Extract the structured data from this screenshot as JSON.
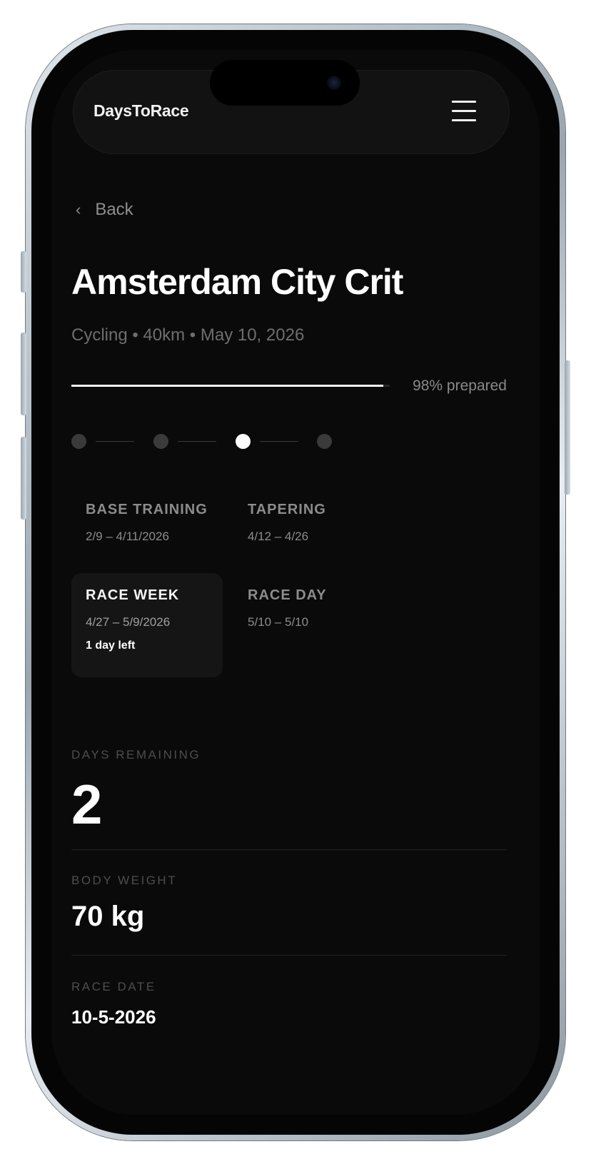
{
  "app": {
    "brand": "DaysToRace"
  },
  "nav": {
    "back_label": "Back"
  },
  "race": {
    "title": "Amsterdam City Crit",
    "subtitle": "Cycling • 40km • May 10, 2026"
  },
  "progress": {
    "percent": 98,
    "label": "98% prepared"
  },
  "stepper": {
    "step_count": 4,
    "current_index": 2
  },
  "phases": [
    {
      "name": "BASE TRAINING",
      "dates": "2/9 – 4/11/2026",
      "days_left": ""
    },
    {
      "name": "TAPERING",
      "dates": "4/12 – 4/26",
      "days_left": ""
    },
    {
      "name": "RACE WEEK",
      "dates": "4/27 – 5/9/2026",
      "days_left": "1 day left"
    },
    {
      "name": "RACE DAY",
      "dates": "5/10 – 5/10",
      "days_left": ""
    }
  ],
  "stats": {
    "days_remaining": {
      "label": "DAYS REMAINING",
      "value": "2"
    },
    "body_weight": {
      "label": "BODY WEIGHT",
      "value": "70 kg"
    },
    "race_date": {
      "label": "RACE DATE",
      "value": "10-5-2026"
    }
  },
  "colors": {
    "background": "#0a0a0a",
    "accent": "#ffffff",
    "muted": "#8c8c8c"
  },
  "icons": {
    "menu": "hamburger-menu-icon",
    "back": "chevron-left-icon"
  }
}
